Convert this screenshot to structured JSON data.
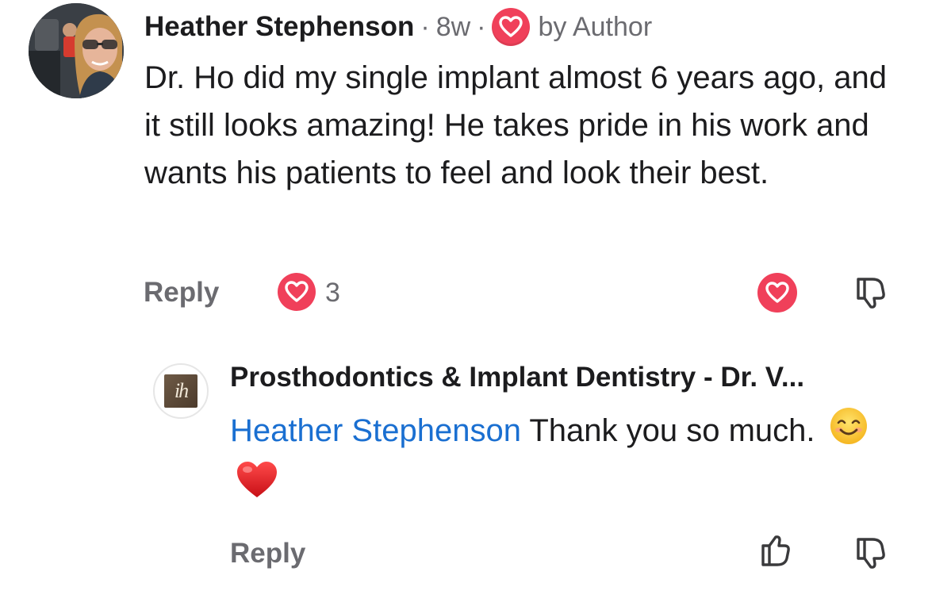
{
  "comment": {
    "author": "Heather Stephenson",
    "age": "8w",
    "separator": "·",
    "author_badge": "by Author",
    "text": "Dr. Ho did my single implant almost 6 years ago, and it still looks amazing! He takes pride in his work and wants his patients to feel and look their best.",
    "reply_label": "Reply",
    "reaction_count": "3",
    "reaction_icon": "heart-icon",
    "like_icon": "heart-icon",
    "dislike_icon": "thumbs-down-icon"
  },
  "reply": {
    "author": "Prosthodontics & Implant Dentistry - Dr. V...",
    "logo_text": "ih",
    "mention": "Heather Stephenson",
    "text": " Thank you so much.",
    "emojis": [
      "smiling-face-icon",
      "red-heart-icon"
    ],
    "reply_label": "Reply",
    "like_icon": "thumbs-up-icon",
    "dislike_icon": "thumbs-down-icon"
  },
  "colors": {
    "heart_red": "#f0405a",
    "mention_blue": "#1a6fd1",
    "meta_gray": "#6b6b70"
  }
}
